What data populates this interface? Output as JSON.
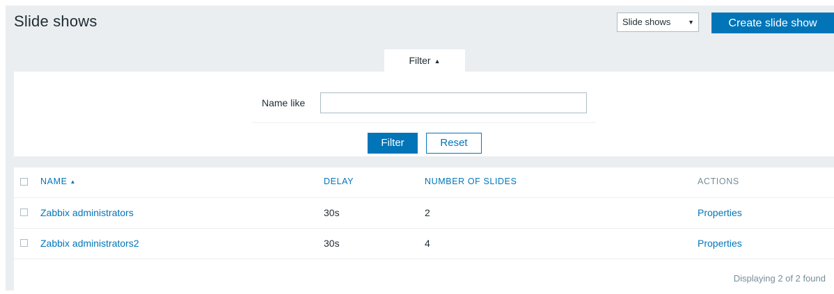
{
  "header": {
    "title": "Slide shows",
    "view_select": {
      "selected": "Slide shows"
    },
    "create_button": "Create slide show"
  },
  "filter": {
    "tab_label": "Filter",
    "name_label": "Name like",
    "name_value": "",
    "filter_button": "Filter",
    "reset_button": "Reset"
  },
  "table": {
    "columns": [
      {
        "label": "NAME",
        "sorted": "asc"
      },
      {
        "label": "DELAY"
      },
      {
        "label": "NUMBER OF SLIDES"
      },
      {
        "label": "ACTIONS"
      }
    ],
    "rows": [
      {
        "name": "Zabbix administrators",
        "delay": "30s",
        "slides": "2",
        "action": "Properties"
      },
      {
        "name": "Zabbix administrators2",
        "delay": "30s",
        "slides": "4",
        "action": "Properties"
      }
    ],
    "footer": "Displaying 2 of 2 found"
  },
  "colors": {
    "accent": "#0275b8",
    "background": "#ebeef0",
    "muted_text": "#768d99"
  }
}
